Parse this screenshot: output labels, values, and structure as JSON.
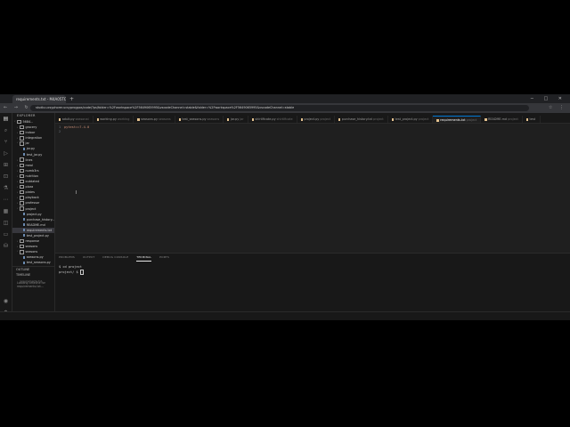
{
  "browser": {
    "tab_title": "requirements.txt - M4A05TO...",
    "new_tab": "+",
    "address": "studio.ucsyphorer.ucsyprogpos/code/?ps/folder=%2Fworkspace%2F5649065995&vscodeChannel=stable&folder=%2Fworkspace%2F5649065995&vscodeChannel=stable",
    "window_controls": "─ □ ✕",
    "nav_icons": "← → ↻",
    "toolbar_icons": "☆ ⋮"
  },
  "sidebar": {
    "header": "EXPLORER",
    "items": [
      {
        "label": "5684...",
        "type": "root",
        "chevron": "˅"
      },
      {
        "label": "grocery",
        "type": "folder",
        "chevron": "›"
      },
      {
        "label": "indoor",
        "type": "folder",
        "chevron": "›"
      },
      {
        "label": "integration",
        "type": "folder",
        "chevron": "›"
      },
      {
        "label": "jar",
        "type": "folder",
        "chevron": "˅"
      },
      {
        "label": "jar.py",
        "type": "file",
        "chevron": ""
      },
      {
        "label": "test_jar.py",
        "type": "file",
        "chevron": ""
      },
      {
        "label": "lines",
        "type": "folder",
        "chevron": "›"
      },
      {
        "label": "meal",
        "type": "folder",
        "chevron": "›"
      },
      {
        "label": "numb3rs",
        "type": "folder",
        "chevron": "›"
      },
      {
        "label": "nutrition",
        "type": "folder",
        "chevron": "›"
      },
      {
        "label": "outdated",
        "type": "folder",
        "chevron": "›"
      },
      {
        "label": "pizza",
        "type": "folder",
        "chevron": "›"
      },
      {
        "label": "plates",
        "type": "folder",
        "chevron": "›"
      },
      {
        "label": "playback",
        "type": "folder",
        "chevron": "›"
      },
      {
        "label": "professor",
        "type": "folder",
        "chevron": "›"
      },
      {
        "label": "project",
        "type": "folder",
        "chevron": "˅"
      },
      {
        "label": "project.py",
        "type": "file",
        "chevron": ""
      },
      {
        "label": "purchase_history...",
        "type": "file",
        "chevron": ""
      },
      {
        "label": "README.md",
        "type": "file",
        "chevron": ""
      },
      {
        "label": "requirements.txt",
        "type": "file",
        "chevron": "",
        "selected": true
      },
      {
        "label": "test_project.py",
        "type": "file",
        "chevron": ""
      },
      {
        "label": "response",
        "type": "folder",
        "chevron": "›"
      },
      {
        "label": "seasons",
        "type": "folder",
        "chevron": "›"
      },
      {
        "label": "seasons",
        "type": "folder",
        "chevron": "˅"
      },
      {
        "label": "seasons.py",
        "type": "file",
        "chevron": ""
      },
      {
        "label": "test_seasons.py",
        "type": "file",
        "chevron": ""
      }
    ],
    "outline": "OUTLINE",
    "timeline": "TIMELINE",
    "timeline_sub": "requirements.txt",
    "loading_1": "Loading timeline for",
    "loading_2": "requirements.txt..."
  },
  "editor": {
    "tabs": [
      {
        "name": "adult.py",
        "hint": "seasonal"
      },
      {
        "name": "working.py",
        "hint": "working"
      },
      {
        "name": "seasons.py",
        "hint": "seasons"
      },
      {
        "name": "test_seasons.py",
        "hint": "seasons"
      },
      {
        "name": "jar.py",
        "hint": "jar"
      },
      {
        "name": "shirtificate.py",
        "hint": "shirtificate"
      },
      {
        "name": "project.py",
        "hint": "project"
      },
      {
        "name": "purchase_history.txt",
        "hint": "project"
      },
      {
        "name": "test_project.py",
        "hint": "project"
      },
      {
        "name": "requirements.txt",
        "hint": "project",
        "active": true
      },
      {
        "name": "README.md",
        "hint": "project"
      },
      {
        "name": "test",
        "hint": ""
      }
    ],
    "lines": [
      {
        "num": "1",
        "text": "pytest==7.4.0"
      },
      {
        "num": "2",
        "text": ""
      }
    ]
  },
  "panel": {
    "tabs": [
      {
        "label": "PROBLEMS"
      },
      {
        "label": "OUTPUT"
      },
      {
        "label": "DEBUG CONSOLE"
      },
      {
        "label": "TERMINAL",
        "active": true
      },
      {
        "label": "PORTS"
      }
    ],
    "terminal_line_1": "$ cd project",
    "terminal_line_2": "project/ $ "
  },
  "icons": {
    "activity_top": [
      "files-icon",
      "search-icon",
      "source-control-icon",
      "run-debug-icon",
      "extensions-icon",
      "remote-icon",
      "testing-icon",
      "more-icon",
      "docker-icon",
      "chat-icon",
      "book-icon",
      "database-icon"
    ],
    "activity_bottom": [
      "account-icon",
      "settings-gear-icon"
    ]
  }
}
